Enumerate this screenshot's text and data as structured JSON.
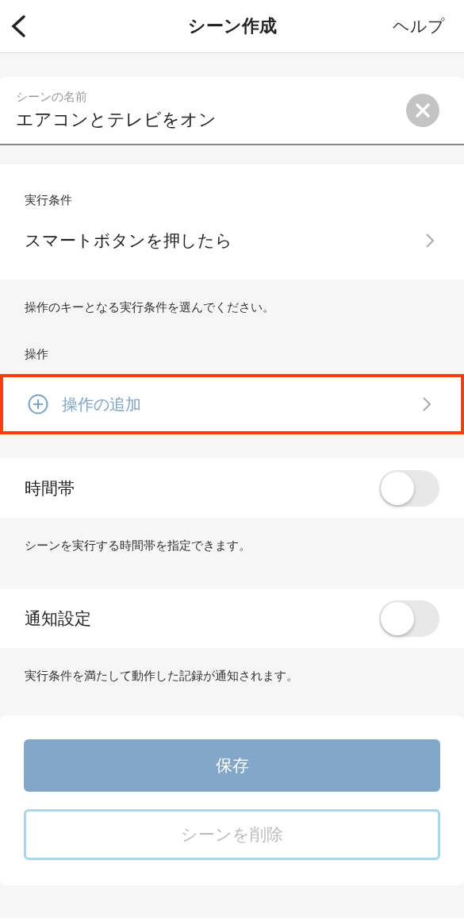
{
  "header": {
    "title": "シーン作成",
    "help": "ヘルプ"
  },
  "name_field": {
    "label": "シーンの名前",
    "value": "エアコンとテレビをオン"
  },
  "condition": {
    "label": "実行条件",
    "value": "スマートボタンを押したら",
    "note": "操作のキーとなる実行条件を選んでください。"
  },
  "action": {
    "label": "操作",
    "add": "操作の追加",
    "highlighted": true
  },
  "toggles": [
    {
      "label": "時間帯",
      "on": false,
      "note": "シーンを実行する時間帯を指定できます。"
    },
    {
      "label": "通知設定",
      "on": false,
      "note": "実行条件を満たして動作した記録が通知されます。"
    }
  ],
  "buttons": [
    {
      "kind": "primary",
      "label": "保存",
      "disabled": true
    },
    {
      "kind": "outline",
      "label": "シーンを削除",
      "disabled": true
    }
  ]
}
